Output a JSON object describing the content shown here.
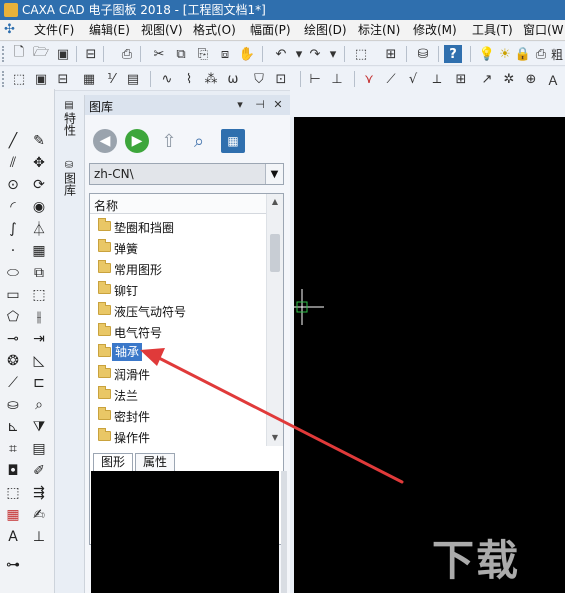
{
  "window": {
    "title": "CAXA CAD 电子图板 2018 - [工程图文档1*]"
  },
  "menubar": {
    "items": [
      "文件(F)",
      "编辑(E)",
      "视图(V)",
      "格式(O)",
      "幅面(P)",
      "绘图(D)",
      "标注(N)",
      "修改(M)",
      "工具(T)",
      "窗口(W"
    ]
  },
  "toolbar1": {
    "icons": [
      "new-file-icon",
      "open-folder-icon",
      "save-icon",
      "print-icon",
      "cut-icon",
      "copy-icon",
      "paste-icon",
      "paste-special-icon",
      "undo-icon",
      "redo-icon",
      "drawing-tools-icon",
      "layers-icon",
      "help-icon",
      "lightbulb-icon"
    ],
    "trailing_text": "粗"
  },
  "side_tabs": {
    "properties": "特性",
    "library": "图库"
  },
  "library_panel": {
    "title": "图库",
    "path": "zh-CN\\",
    "column_header": "名称",
    "items": [
      {
        "label": "垫圈和挡圈",
        "selected": false
      },
      {
        "label": "弹簧",
        "selected": false
      },
      {
        "label": "常用图形",
        "selected": false
      },
      {
        "label": "铆钉",
        "selected": false
      },
      {
        "label": "液压气动符号",
        "selected": false
      },
      {
        "label": "电气符号",
        "selected": false
      },
      {
        "label": "轴承",
        "selected": true
      },
      {
        "label": "润滑件",
        "selected": false
      },
      {
        "label": "法兰",
        "selected": false
      },
      {
        "label": "密封件",
        "selected": false
      },
      {
        "label": "操作件",
        "selected": false
      }
    ],
    "preview_tabs": [
      "图形",
      "属性"
    ],
    "active_preview_tab": "图形"
  },
  "annotation": {
    "arrow_color": "#e03a3a"
  },
  "watermark": {
    "text": "下载吧"
  },
  "colors": {
    "canvas": "#000000",
    "selection": "#3b78c9",
    "title_bar": "#2f6fae"
  }
}
